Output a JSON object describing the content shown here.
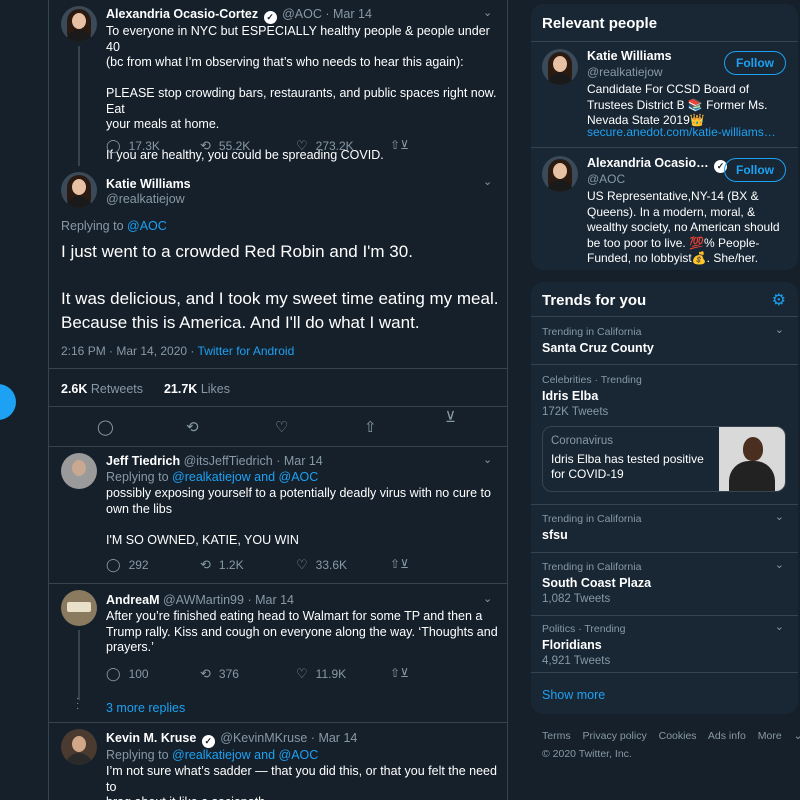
{
  "tweets": {
    "aoc": {
      "name": "Alexandria Ocasio-Cortez",
      "handle": "@AOC",
      "date": "Mar 14",
      "text": "To everyone in NYC but ESPECIALLY healthy people & people under 40\n(bc from what I’m observing that’s who needs to hear this again):\n\nPLEASE stop crowding bars, restaurants, and public spaces right now. Eat\nyour meals at home.\n\nIf you are healthy, you could be spreading COVID.",
      "replies": "17.3K",
      "retweets": "55.2K",
      "likes": "273.2K"
    },
    "main": {
      "name": "Katie Williams",
      "handle": "@realkatiejow",
      "replying_prefix": "Replying to ",
      "replying_to": "@AOC",
      "text": "I just went to a crowded Red Robin and I'm 30.\n\nIt was delicious, and I took my sweet time eating my meal.\nBecause this is America. And I'll do what I want.",
      "timestamp": "2:16 PM · Mar 14, 2020",
      "source": "Twitter for Android",
      "retweets_count": "2.6K",
      "retweets_label": "Retweets",
      "likes_count": "21.7K",
      "likes_label": "Likes"
    },
    "jeff": {
      "name": "Jeff Tiedrich",
      "handle": "@itsJeffTiedrich",
      "date": "Mar 14",
      "replying_prefix": "Replying to ",
      "replying_to": "@realkatiejow and @AOC",
      "text": "possibly exposing yourself to a potentially deadly virus with no cure to\nown the libs\n\nI'M SO OWNED, KATIE, YOU WIN",
      "replies": "292",
      "retweets": "1.2K",
      "likes": "33.6K"
    },
    "andrea": {
      "name": "AndreaM",
      "handle": "@AWMartin99",
      "date": "Mar 14",
      "text": "After you’re finished eating head to Walmart for some TP and then a\nTrump rally. Kiss and cough on everyone along the way. ‘Thoughts and\nprayers.’",
      "replies": "100",
      "retweets": "376",
      "likes": "11.9K"
    },
    "more_replies": "3 more replies",
    "kevin": {
      "name": "Kevin M. Kruse",
      "handle": "@KevinMKruse",
      "date": "Mar 14",
      "replying_prefix": "Replying to ",
      "replying_to": "@realkatiejow and @AOC",
      "text": "I’m not sure what’s sadder — that you did this, or that you felt the need to\nbrag about it like a sociopath."
    }
  },
  "relevant_people": {
    "title": "Relevant people",
    "people": [
      {
        "name": "Katie Williams",
        "handle": "@realkatiejow",
        "bio": "Candidate For CCSD Board of\nTrustees District B 📚 Former Ms.\nNevada State 2019👑",
        "link": "secure.anedot.com/katie-williams…",
        "follow": "Follow"
      },
      {
        "name": "Alexandria Ocasio…",
        "handle": "@AOC",
        "bio": "US Representative,NY-14 (BX &\nQueens). In a modern, moral, &\nwealthy society, no American should\nbe too poor to live. 💯% People-\nFunded, no lobbyist💰. She/her.",
        "follow": "Follow"
      }
    ]
  },
  "trends": {
    "title": "Trends for you",
    "items": [
      {
        "context": "Trending in California",
        "name": "Santa Cruz County",
        "count": ""
      },
      {
        "context": "Celebrities · Trending",
        "name": "Idris Elba",
        "count": "172K Tweets"
      },
      {
        "context": "Trending in California",
        "name": "sfsu",
        "count": ""
      },
      {
        "context": "Trending in California",
        "name": "South Coast Plaza",
        "count": "1,082 Tweets"
      },
      {
        "context": "Politics · Trending",
        "name": "Floridians",
        "count": "4,921 Tweets"
      }
    ],
    "news": {
      "category": "Coronavirus",
      "text": "Idris Elba has tested positive for COVID-19"
    },
    "show_more": "Show more"
  },
  "footer": {
    "links": [
      "Terms",
      "Privacy policy",
      "Cookies",
      "Ads info",
      "More"
    ],
    "copyright": "© 2020 Twitter, Inc."
  },
  "colors": {
    "background": "#15202b",
    "card": "#192734",
    "accent": "#1da1f2",
    "muted": "#8899a6",
    "border": "#38444d"
  }
}
